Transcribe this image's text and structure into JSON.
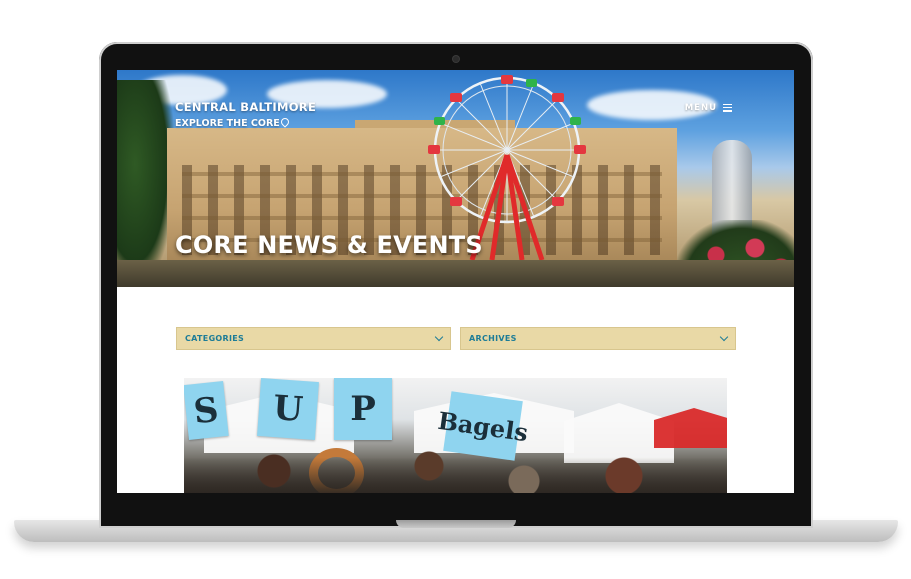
{
  "site": {
    "logo_line1": "CENTRAL BALTIMORE",
    "logo_line2_prefix": "EXPLORE THE ",
    "logo_line2_core": "CORE",
    "menu_label": "MENU",
    "menu_icon": "hamburger-icon"
  },
  "hero": {
    "title": "CORE NEWS & EVENTS"
  },
  "filters": {
    "categories_label": "CATEGORIES",
    "archives_label": "ARCHIVES",
    "dropdown_icon": "chevron-down-icon"
  },
  "post": {
    "sign_letters": [
      "S",
      "U",
      "P"
    ],
    "sign_bagels": "Bagels"
  },
  "colors": {
    "filter_bg": "#e9d9a6",
    "filter_text": "#1d7c97",
    "frame": "#111111"
  }
}
